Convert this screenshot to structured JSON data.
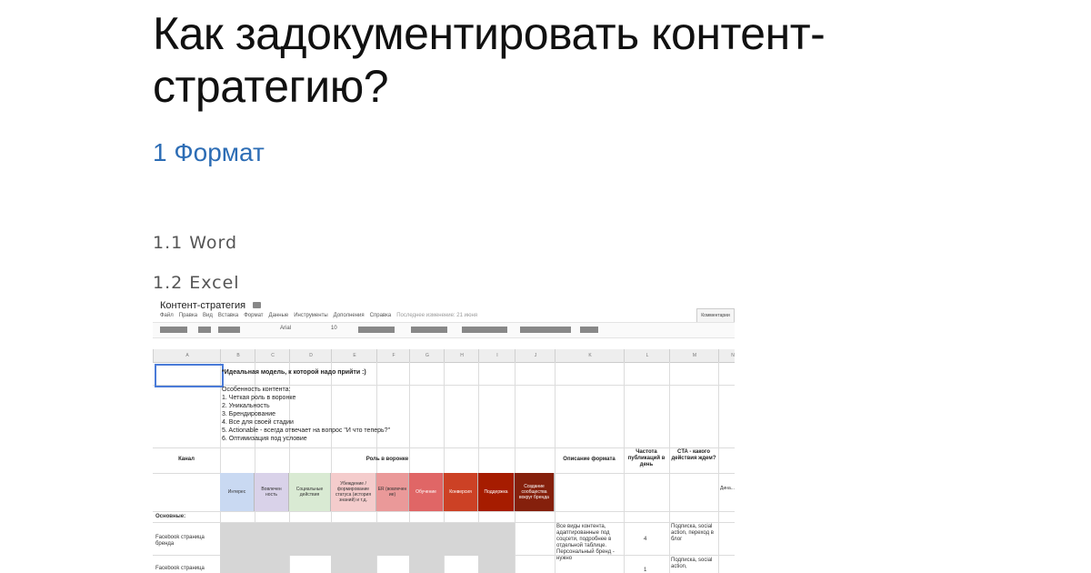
{
  "page": {
    "title": "Как задокументировать контент-стратегию?",
    "section": "1 Формат",
    "sub_word": "1.1 Word",
    "sub_excel": "1.2 Excel"
  },
  "sheet": {
    "doc_title": "Контент-стратегия",
    "comments_label": "Комментарии",
    "menu": [
      "Файл",
      "Правка",
      "Вид",
      "Вставка",
      "Формат",
      "Данные",
      "Инструменты",
      "Дополнения",
      "Справка",
      "Последнее изменение: 21 июня"
    ],
    "toolbar": {
      "font": "Arial",
      "size": "10"
    },
    "columns": [
      "A",
      "B",
      "C",
      "D",
      "E",
      "F",
      "G",
      "H",
      "I",
      "J",
      "K",
      "L",
      "M",
      "N"
    ],
    "ideal_text": "*Идеальная модель, к которой надо прийти :)",
    "features_title": "Особенность контента:",
    "features": [
      "1. Четкая роль в воронке",
      "2. Уникальность",
      "3. Брендирование",
      "4. Все для своей стадии",
      "5. Actionable - всегда отвечает на вопрос \"И что теперь?\"",
      "6. Оптимизация под условие"
    ],
    "header_channel": "Канал",
    "header_funnel": "Роль в воронке",
    "header_format": "Описание формата",
    "header_freq": "Частота публикаций в день",
    "header_cta": "CTA - какого действия ждем?",
    "header_n": "Дина...",
    "roles": [
      {
        "label": "Интерес",
        "color": "#c9d9f2"
      },
      {
        "label": "Вовлечен ность",
        "color": "#d9d2e9"
      },
      {
        "label": "Социальные действия",
        "color": "#d9ead3"
      },
      {
        "label": "Убеждение / формирование статуса (история знаний) и т.д.",
        "color": "#f4cccc"
      },
      {
        "label": "ER (вовлечен ие)",
        "color": "#ea9999"
      },
      {
        "label": "Обучение",
        "color": "#e06666"
      },
      {
        "label": "Конверсия",
        "color": "#cc4125"
      },
      {
        "label": "Поддержка",
        "color": "#a61c00"
      },
      {
        "label": "Создание сообщества вокруг бренда",
        "color": "#85200c"
      }
    ],
    "group_label": "Основные:",
    "row1_label": "Facebook страница бренда",
    "row2_label": "Facebook страница",
    "format_text": "Все виды контента, адаптированные под соцсети, подробнее в отдельной таблице. Персональный бренд - нужно",
    "freq_value": "4",
    "freq_value2": "1",
    "cta_text": "Подписка, social action, переход в блог",
    "cta_text2": "Подписка, social action,"
  }
}
